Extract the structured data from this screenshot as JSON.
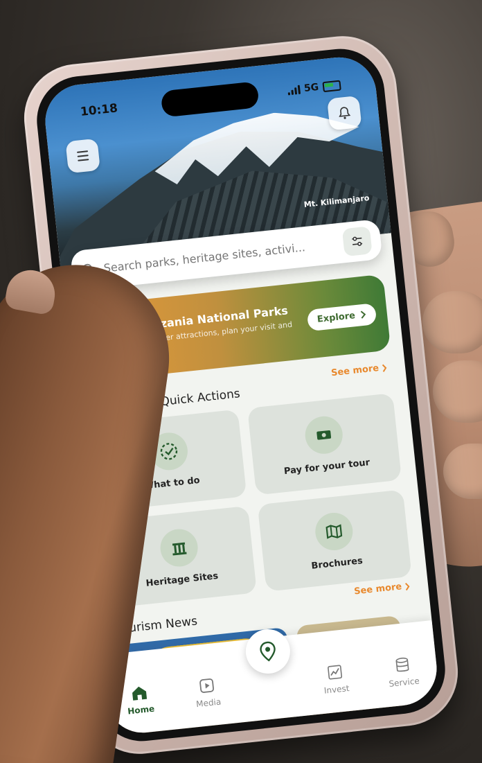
{
  "status": {
    "time": "10:18",
    "network": "5G"
  },
  "hero": {
    "caption": "Mt. Kilimanjaro"
  },
  "search": {
    "placeholder": "Search parks, heritage sites, activi..."
  },
  "banner": {
    "title": "Tanzania National Parks",
    "subtitle": "Discover attractions, plan your visit and more",
    "button": "Explore"
  },
  "quick_actions": {
    "title": "Explore Quick Actions",
    "see_more": "See more",
    "items": [
      {
        "label": "What to do",
        "icon": "clock-check-icon"
      },
      {
        "label": "Pay for your tour",
        "icon": "money-icon"
      },
      {
        "label": "Heritage Sites",
        "icon": "monument-icon"
      },
      {
        "label": "Brochures",
        "icon": "map-icon"
      }
    ]
  },
  "news": {
    "title": "Tourism News",
    "see_more": "See more"
  },
  "tabbar": {
    "items": [
      {
        "label": "Home",
        "icon": "home-icon",
        "active": true
      },
      {
        "label": "Media",
        "icon": "media-icon"
      },
      {
        "label": "Invest",
        "icon": "chart-icon"
      },
      {
        "label": "Service",
        "icon": "database-icon"
      }
    ]
  },
  "colors": {
    "accent": "#e8892e",
    "primary_green": "#245a2c",
    "tile_bg": "#dde2dc"
  }
}
